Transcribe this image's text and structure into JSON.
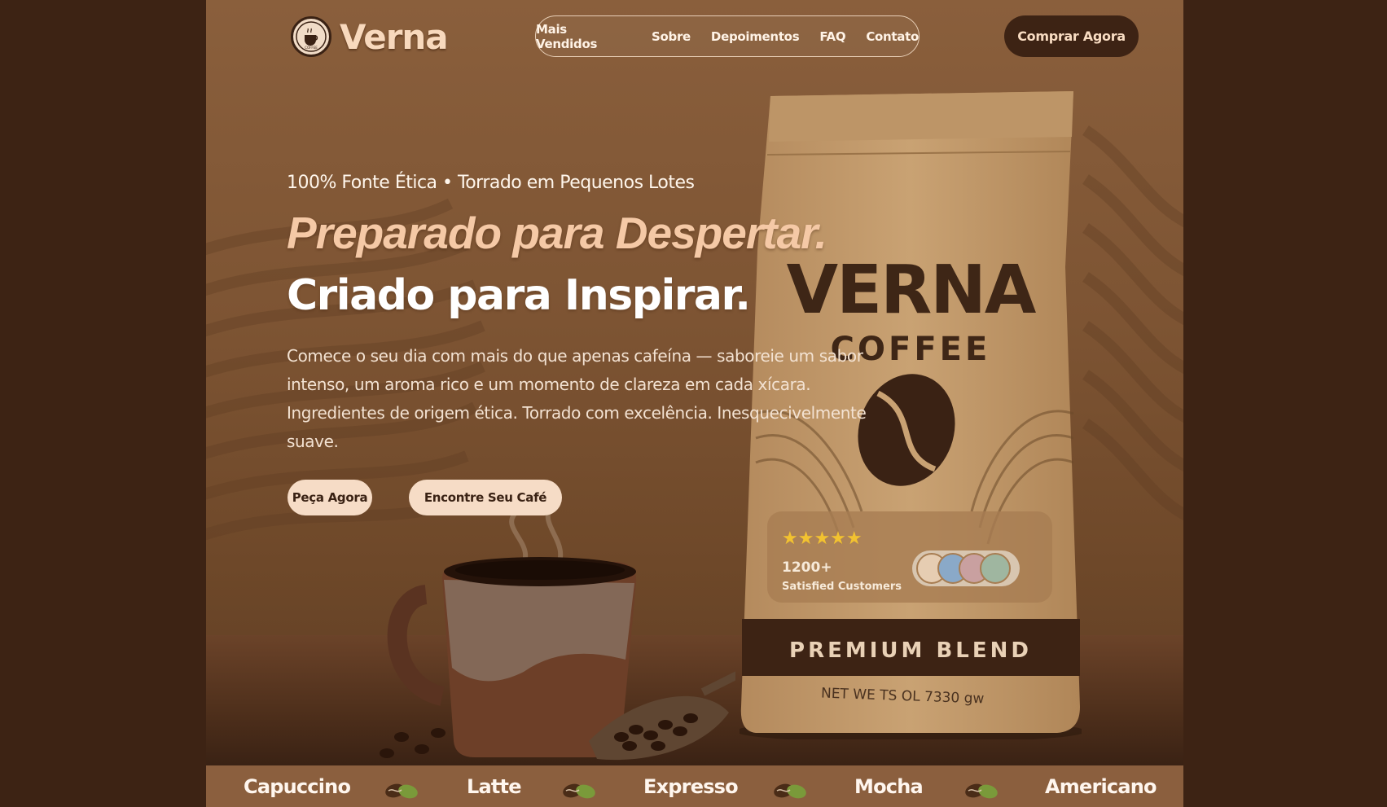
{
  "brand": {
    "name": "Verna",
    "badge_text": "COFFEE"
  },
  "nav": {
    "items": [
      {
        "label": "Mais Vendidos"
      },
      {
        "label": "Sobre"
      },
      {
        "label": "Depoimentos"
      },
      {
        "label": "FAQ"
      },
      {
        "label": "Contato"
      }
    ]
  },
  "header": {
    "cta_label": "Comprar Agora"
  },
  "hero": {
    "eyebrow": "100% Fonte Ética • Torrado em Pequenos Lotes",
    "headline_line1": "Preparado para Despertar.",
    "headline_line2": "Criado para Inspirar.",
    "description": "Comece o seu dia com mais do que apenas cafeína — saboreie um sabor intenso, um aroma rico e um momento de clareza em cada xícara. Ingredientes de origem ética. Torrado com excelência. Inesquecivelmente suave.",
    "primary_button": "Peça Agora",
    "secondary_button": "Encontre Seu Café"
  },
  "product_bag": {
    "brand": "VERNA",
    "subtitle": "COFFEE",
    "rating_stars": 5,
    "customers_count": "1200+",
    "customers_label": "Satisfied Customers",
    "band_label": "PREMIUM BLEND",
    "net_weight": "NET WE TS OL 7330 gw"
  },
  "strip": {
    "items": [
      "Capuccino",
      "Latte",
      "Expresso",
      "Mocha",
      "Americano"
    ]
  },
  "colors": {
    "page_background": "#3d2314",
    "accent_peach": "#f6dcc6",
    "dark_brown": "#3d2314",
    "star_yellow": "#f2c230"
  }
}
